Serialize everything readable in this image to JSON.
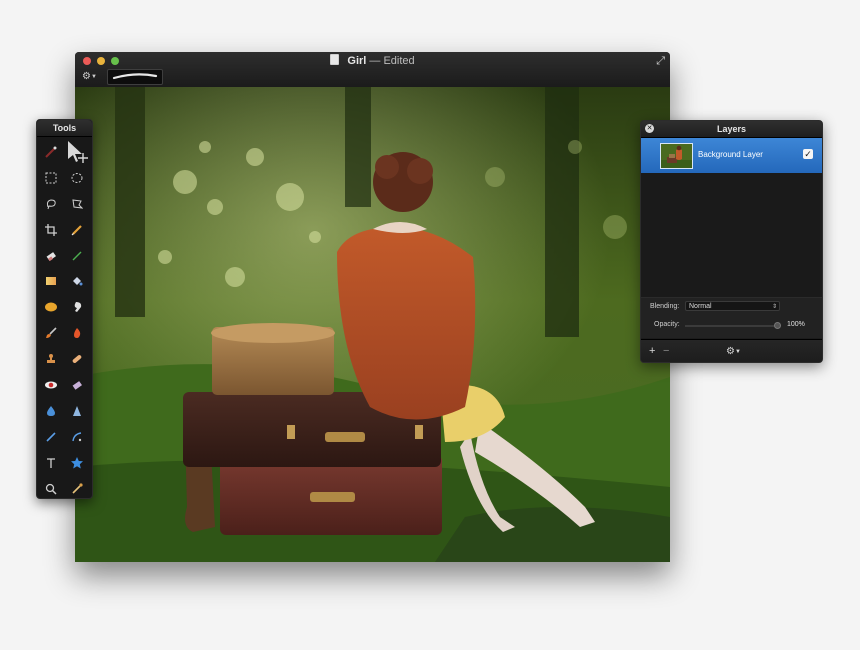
{
  "window": {
    "title": "Girl",
    "title_suffix": "— Edited",
    "traffic_lights": {
      "close": "#ec5b57",
      "minimize": "#e9b33c",
      "maximize": "#67c04b"
    },
    "icons": {
      "document": "document-icon",
      "fullscreen": "fullscreen-icon",
      "gear": "gear-icon"
    }
  },
  "tools": {
    "title": "Tools",
    "items": [
      "magic-wand-icon",
      "move-icon",
      "rectangular-select-icon",
      "elliptical-select-icon",
      "lasso-icon",
      "polygon-lasso-icon",
      "crop-icon",
      "pen-icon",
      "eraser-icon",
      "pencil-icon",
      "gradient-icon",
      "paint-bucket-icon",
      "smudge-icon",
      "clone-stamp-icon",
      "brush-icon",
      "burn-icon",
      "stamp-icon",
      "bandage-icon",
      "red-eye-icon",
      "erase-block-icon",
      "blur-drop-icon",
      "sharpen-icon",
      "line-icon",
      "bezier-icon",
      "text-icon",
      "shape-star-icon",
      "zoom-icon",
      "eyedropper-icon"
    ]
  },
  "layers": {
    "title": "Layers",
    "items": [
      {
        "name": "Background Layer",
        "visible": true
      }
    ],
    "blending_label": "Blending:",
    "blending_value": "Normal",
    "opacity_label": "Opacity:",
    "opacity_value": "100%",
    "opacity_fraction": 1.0,
    "footer_add": "+",
    "footer_remove": "−",
    "selection_color": "#2f78cc"
  }
}
